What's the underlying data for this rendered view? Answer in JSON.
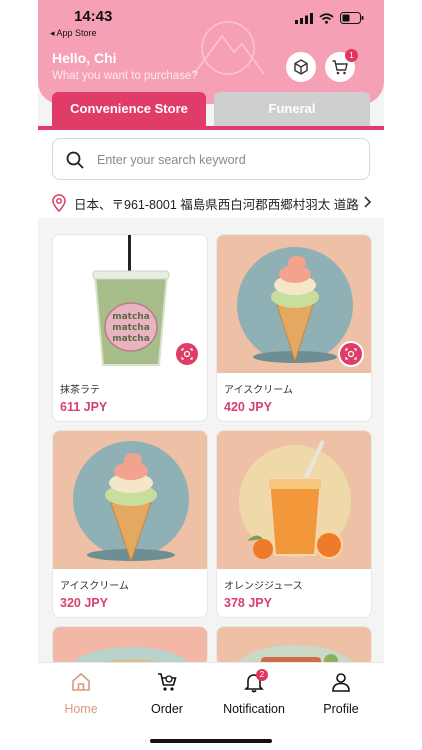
{
  "status": {
    "time": "14:43",
    "back_app": "◂ App Store"
  },
  "header": {
    "greeting": "Hello, Chi",
    "subtitle": "What you want to purchase?",
    "ar_icon": "ar-cube-icon",
    "cart_icon": "cart-icon",
    "cart_badge": "1"
  },
  "tabs": [
    {
      "label": "Convenience Store",
      "active": true
    },
    {
      "label": "Funeral",
      "active": false
    }
  ],
  "search": {
    "placeholder": "Enter your search keyword",
    "value": ""
  },
  "address": {
    "text": "日本、〒961-8001 福島県西白河郡西郷村羽太 道路"
  },
  "products": [
    {
      "name": "抹茶ラテ",
      "price": "611 JPY",
      "image": "matcha-latte",
      "ar": true
    },
    {
      "name": "アイスクリーム",
      "price": "420 JPY",
      "image": "ice-cream",
      "ar": true
    },
    {
      "name": "アイスクリーム",
      "price": "320 JPY",
      "image": "ice-cream",
      "ar": false
    },
    {
      "name": "オレンジジュース",
      "price": "378 JPY",
      "image": "orange-juice",
      "ar": false
    }
  ],
  "nav": [
    {
      "label": "Home",
      "icon": "home-icon",
      "active": true
    },
    {
      "label": "Order",
      "icon": "order-icon",
      "active": false
    },
    {
      "label": "Notification",
      "icon": "bell-icon",
      "active": false,
      "badge": "2"
    },
    {
      "label": "Profile",
      "icon": "profile-icon",
      "active": false
    }
  ],
  "colors": {
    "accent": "#e03c68",
    "header": "#f6a0b6",
    "price": "#d8416c",
    "home_active": "#d89a80"
  }
}
